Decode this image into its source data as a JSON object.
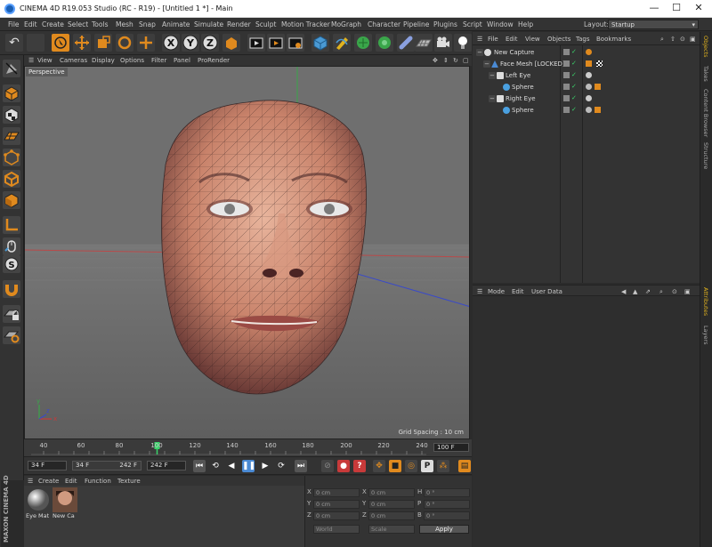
{
  "window": {
    "title": "CINEMA 4D R19.053 Studio (RC - R19) - [Untitled 1 *] - Main",
    "controls": [
      "—",
      "☐",
      "✕"
    ]
  },
  "menu": [
    "File",
    "Edit",
    "Create",
    "Select",
    "Tools",
    "Mesh",
    "Snap",
    "Animate",
    "Simulate",
    "Render",
    "Sculpt",
    "Motion Tracker",
    "MoGraph",
    "Character",
    "Pipeline",
    "Plugins",
    "Script",
    "Window",
    "Help"
  ],
  "layout": {
    "label": "Layout:",
    "value": "Startup"
  },
  "viewport": {
    "menu": [
      "View",
      "Cameras",
      "Display",
      "Options",
      "Filter",
      "Panel",
      "ProRender"
    ],
    "label": "Perspective",
    "grid_spacing": "Grid Spacing : 10 cm",
    "axis_labels": [
      "y",
      "x",
      "z"
    ]
  },
  "timeline": {
    "ticks": [
      "40",
      "60",
      "80",
      "100",
      "120",
      "140",
      "160",
      "180",
      "200",
      "220",
      "240"
    ],
    "current_frame": "100 F",
    "playhead_frame": 100
  },
  "animbar": {
    "start": "34 F",
    "min": "34 F",
    "max": "242 F",
    "end": "242 F"
  },
  "materials": {
    "menu": [
      "Create",
      "Edit",
      "Function",
      "Texture"
    ],
    "items": [
      "Eye Mat",
      "New Ca"
    ],
    "brand": "MAXON CINEMA 4D"
  },
  "coords": {
    "rows": [
      {
        "a": "X",
        "av": "0 cm",
        "b": "X",
        "bv": "0 cm",
        "c": "H",
        "cv": "0 °"
      },
      {
        "a": "Y",
        "av": "0 cm",
        "b": "Y",
        "bv": "0 cm",
        "c": "P",
        "cv": "0 °"
      },
      {
        "a": "Z",
        "av": "0 cm",
        "b": "Z",
        "bv": "0 cm",
        "c": "B",
        "cv": "0 °"
      }
    ],
    "mode_a": "World",
    "mode_b": "Scale",
    "apply": "Apply"
  },
  "objects": {
    "menu": [
      "File",
      "Edit",
      "View",
      "Objects",
      "Tags",
      "Bookmarks"
    ],
    "items": [
      {
        "name": "New Capture",
        "indent": 0
      },
      {
        "name": "Face Mesh [LOCKED]",
        "indent": 1
      },
      {
        "name": "Left Eye",
        "indent": 2
      },
      {
        "name": "Sphere",
        "indent": 3
      },
      {
        "name": "Right Eye",
        "indent": 2
      },
      {
        "name": "Sphere",
        "indent": 3
      }
    ]
  },
  "attributes": {
    "menu": [
      "Mode",
      "Edit",
      "User Data"
    ]
  },
  "right_tabs": [
    "Objects",
    "Takes",
    "Content Browser",
    "Structure",
    "Attributes",
    "Layers"
  ],
  "colors": {
    "accent": "#4a8ad4",
    "orange": "#e08a1e",
    "bg": "#333333",
    "viewport": "#6f6f6f"
  }
}
